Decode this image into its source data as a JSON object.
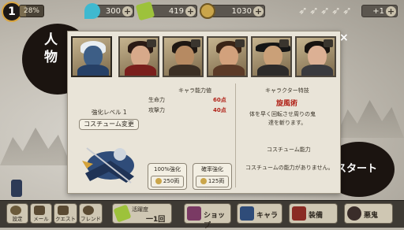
{
  "hud": {
    "level": "1",
    "exp_percent_label": "28%",
    "exp_fraction": 0.28,
    "resources": [
      {
        "name": "gem",
        "value": "300",
        "icon": "blue-drop-icon",
        "color": "#3fb9d0"
      },
      {
        "name": "scroll",
        "value": "419",
        "icon": "scroll-icon",
        "color": "#9dc23b"
      },
      {
        "name": "coin",
        "value": "1030",
        "icon": "coin-icon",
        "color": "#caa54a"
      }
    ],
    "stamina": {
      "icon": "kunai-icon",
      "count": 5,
      "extra": "+1"
    }
  },
  "side": {
    "jinbutsu": "人物",
    "start_fragment": "スタート"
  },
  "panel": {
    "close": "×",
    "stats_title": "キャラ能力値",
    "hp_label": "生命力",
    "hp_value": "60点",
    "atk_label": "攻撃力",
    "atk_value": "40点",
    "enhance_level": "強化レベル 1",
    "costume_change_button": "コスチューム変更",
    "skill_title": "キャラクター特技",
    "skill_name": "旋風術",
    "skill_desc_1": "体を早く回転させ周りの鬼",
    "skill_desc_2": "達を斬ります。",
    "costume_ability_title": "コスチューム能力",
    "costume_ability_text": "コスチュームの能力がありません。",
    "full_enhance_label": "100%強化",
    "full_enhance_cost": "250両",
    "half_enhance_label": "確率強化",
    "half_enhance_cost": "125両"
  },
  "bottom": {
    "settings": "設定",
    "mail": "メール",
    "quest": "クエスト",
    "friend": "フレンド",
    "activity_label": "活躍度",
    "activity_value": "一1回",
    "shop": "ショップ",
    "chara": "キャラ",
    "equip": "装備",
    "oni": "悪鬼"
  },
  "colors": {
    "accent_red": "#b1241a",
    "panel_bg": "#e9e4d8",
    "bar_bg": "#3e3a34"
  }
}
